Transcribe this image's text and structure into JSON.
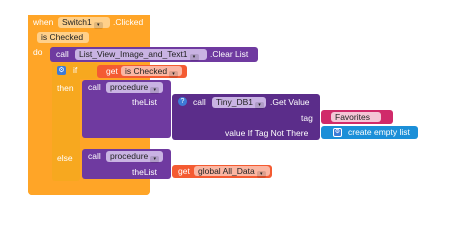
{
  "event": {
    "when_label": "when",
    "component": "Switch1",
    "event_name": ".Clicked",
    "param": "is Checked",
    "do_label": "do"
  },
  "clear_call": {
    "call_label": "call",
    "component": "List_View_Image_and_Text1",
    "method": ".Clear List"
  },
  "if_block": {
    "if_label": "if",
    "get_label": "get",
    "get_var": "is Checked",
    "then_label": "then",
    "else_label": "else"
  },
  "then_call": {
    "call_label": "call",
    "procedure": "procedure",
    "arg_label": "theList"
  },
  "get_value": {
    "call_label": "call",
    "component": "Tiny_DB1",
    "method": ".Get Value",
    "tag_label": "tag",
    "tag_value": "Favorites",
    "default_label": "value If Tag Not There",
    "create_list": "create empty list"
  },
  "else_call": {
    "call_label": "call",
    "procedure": "procedure",
    "arg_label": "theList",
    "get_label": "get",
    "get_var": "global All_Data"
  },
  "colors": {
    "event": "#ffa527",
    "procedure": "#6f3aa0",
    "control": "#f7a81f",
    "variable": "#f45b32",
    "text": "#d02a6a",
    "list": "#1b8fd8"
  },
  "icons": [
    "gear-icon",
    "question-icon",
    "dropdown-icon"
  ]
}
